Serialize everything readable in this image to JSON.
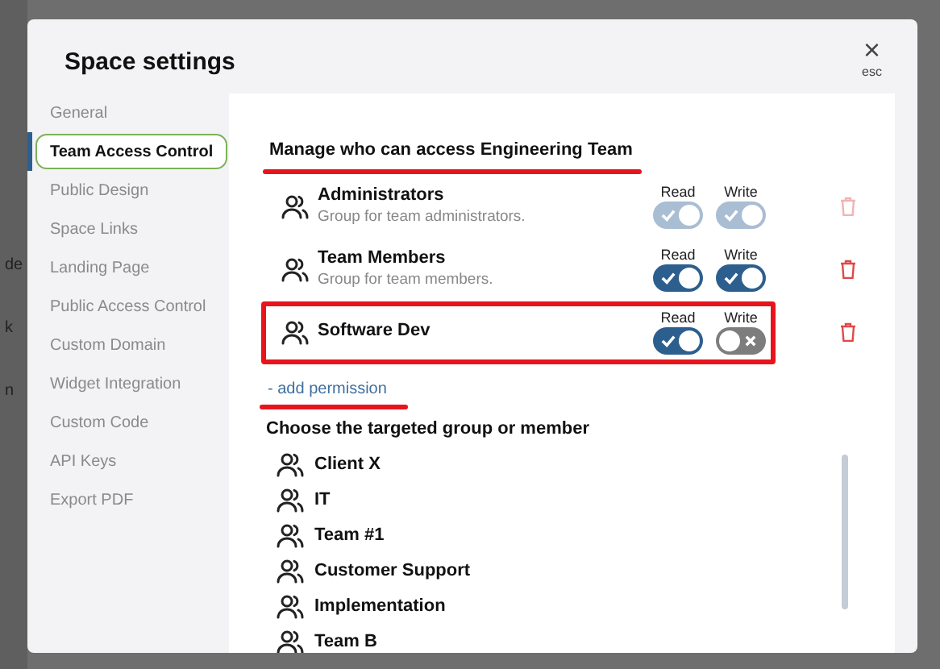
{
  "background_fragments": [
    "de",
    "k",
    "n"
  ],
  "dialog": {
    "title": "Space settings",
    "close": {
      "glyph": "×",
      "hint": "esc"
    }
  },
  "sidebar": {
    "items": [
      {
        "label": "General",
        "selected": false
      },
      {
        "label": "Team Access Control",
        "selected": true
      },
      {
        "label": "Public Design",
        "selected": false
      },
      {
        "label": "Space Links",
        "selected": false
      },
      {
        "label": "Landing Page",
        "selected": false
      },
      {
        "label": "Public Access Control",
        "selected": false
      },
      {
        "label": "Custom Domain",
        "selected": false
      },
      {
        "label": "Widget Integration",
        "selected": false
      },
      {
        "label": "Custom Code",
        "selected": false
      },
      {
        "label": "API Keys",
        "selected": false
      },
      {
        "label": "Export PDF",
        "selected": false
      }
    ]
  },
  "access": {
    "heading": "Manage who can access Engineering Team",
    "heading_underlined": true,
    "rows": [
      {
        "name": "Administrators",
        "description": "Group for team administrators.",
        "disabled": true,
        "highlighted": false,
        "read_label": "Read",
        "write_label": "Write",
        "read": true,
        "write": true
      },
      {
        "name": "Team Members",
        "description": "Group for team members.",
        "disabled": false,
        "highlighted": false,
        "read_label": "Read",
        "write_label": "Write",
        "read": true,
        "write": true
      },
      {
        "name": "Software Dev",
        "disabled": false,
        "highlighted": true,
        "read_label": "Read",
        "write_label": "Write",
        "read": true,
        "write": false
      }
    ],
    "add_link": "- add permission",
    "add_link_underlined": true
  },
  "picker": {
    "heading": "Choose the targeted group or member",
    "items": [
      "Client X",
      "IT",
      "Team #1",
      "Customer Support",
      "Implementation",
      "Team B"
    ]
  }
}
